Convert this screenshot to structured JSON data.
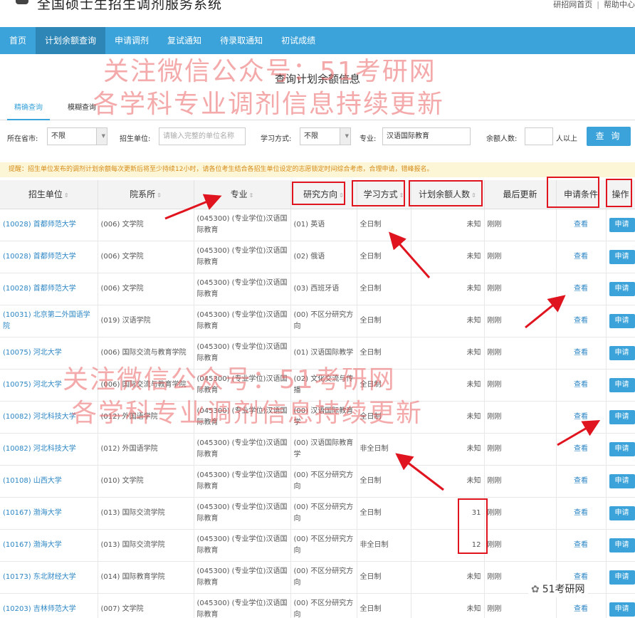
{
  "header": {
    "site_title": "全国硕士生招生调剂服务系统",
    "links": [
      "研招网首页",
      "帮助中心"
    ],
    "separator": "|"
  },
  "nav": {
    "items": [
      "首页",
      "计划余额查询",
      "申请调剂",
      "复试通知",
      "待录取通知",
      "初试成绩"
    ],
    "active_index": 1
  },
  "page_heading": "查询计划余额信息",
  "tabs": [
    "精确查询",
    "模糊查询"
  ],
  "filters": {
    "province_label": "所在省市:",
    "province_value": "不限",
    "unit_label": "招生单位:",
    "unit_placeholder": "请输入完整的单位名称",
    "mode_label": "学习方式:",
    "mode_value": "不限",
    "major_label": "专业:",
    "major_value": "汉语国际教育",
    "remaining_label": "余额人数:",
    "remaining_value": "",
    "remaining_suffix": "人以上",
    "query_button": "查 询"
  },
  "notice": "提醒：招生单位发布的调剂计划余额每次更新后将至少持续12小时，请各位考生结合各招生单位设定的志愿锁定时间综合考虑，合理申请，错峰报名。",
  "table": {
    "columns": [
      "招生单位",
      "院系所",
      "专业",
      "研究方向",
      "学习方式",
      "计划余额人数",
      "最后更新",
      "申请条件",
      "操作"
    ],
    "view_label": "查看",
    "apply_label": "申请",
    "rows": [
      {
        "unit": "(10028) 首都师范大学",
        "dept": "(006) 文学院",
        "major": "(045300) (专业学位)汉语国际教育",
        "direction": "(01) 英语",
        "mode": "全日制",
        "remaining": "未知",
        "updated": "刚刚"
      },
      {
        "unit": "(10028) 首都师范大学",
        "dept": "(006) 文学院",
        "major": "(045300) (专业学位)汉语国际教育",
        "direction": "(02) 俄语",
        "mode": "全日制",
        "remaining": "未知",
        "updated": "刚刚"
      },
      {
        "unit": "(10028) 首都师范大学",
        "dept": "(006) 文学院",
        "major": "(045300) (专业学位)汉语国际教育",
        "direction": "(03) 西班牙语",
        "mode": "全日制",
        "remaining": "未知",
        "updated": "刚刚"
      },
      {
        "unit": "(10031) 北京第二外国语学院",
        "dept": "(019) 汉语学院",
        "major": "(045300) (专业学位)汉语国际教育",
        "direction": "(00) 不区分研究方向",
        "mode": "全日制",
        "remaining": "未知",
        "updated": "刚刚"
      },
      {
        "unit": "(10075) 河北大学",
        "dept": "(006) 国际交流与教育学院",
        "major": "(045300) (专业学位)汉语国际教育",
        "direction": "(01) 汉语国际教学",
        "mode": "全日制",
        "remaining": "未知",
        "updated": "刚刚"
      },
      {
        "unit": "(10075) 河北大学",
        "dept": "(006) 国际交流与教育学院",
        "major": "(045300) (专业学位)汉语国际教育",
        "direction": "(02) 文化交流与传播",
        "mode": "全日制",
        "remaining": "未知",
        "updated": "刚刚"
      },
      {
        "unit": "(10082) 河北科技大学",
        "dept": "(012) 外国语学院",
        "major": "(045300) (专业学位)汉语国际教育",
        "direction": "(00) 汉语国际教育学",
        "mode": "全日制",
        "remaining": "未知",
        "updated": "刚刚"
      },
      {
        "unit": "(10082) 河北科技大学",
        "dept": "(012) 外国语学院",
        "major": "(045300) (专业学位)汉语国际教育",
        "direction": "(00) 汉语国际教育学",
        "mode": "非全日制",
        "remaining": "未知",
        "updated": "刚刚"
      },
      {
        "unit": "(10108) 山西大学",
        "dept": "(010) 文学院",
        "major": "(045300) (专业学位)汉语国际教育",
        "direction": "(00) 不区分研究方向",
        "mode": "全日制",
        "remaining": "未知",
        "updated": "刚刚"
      },
      {
        "unit": "(10167) 渤海大学",
        "dept": "(013) 国际交流学院",
        "major": "(045300) (专业学位)汉语国际教育",
        "direction": "(00) 不区分研究方向",
        "mode": "全日制",
        "remaining": "31",
        "updated": "刚刚"
      },
      {
        "unit": "(10167) 渤海大学",
        "dept": "(013) 国际交流学院",
        "major": "(045300) (专业学位)汉语国际教育",
        "direction": "(00) 不区分研究方向",
        "mode": "非全日制",
        "remaining": "12",
        "updated": "刚刚"
      },
      {
        "unit": "(10173) 东北财经大学",
        "dept": "(014) 国际教育学院",
        "major": "(045300) (专业学位)汉语国际教育",
        "direction": "(00) 不区分研究方向",
        "mode": "全日制",
        "remaining": "未知",
        "updated": "刚刚"
      },
      {
        "unit": "(10203) 吉林师范大学",
        "dept": "(007) 文学院",
        "major": "(045300) (专业学位)汉语国际教育",
        "direction": "(00) 不区分研究方向",
        "mode": "全日制",
        "remaining": "未知",
        "updated": "刚刚"
      }
    ]
  },
  "watermarks": [
    "关注微信公众号：51考研网",
    "各学科专业调剂信息持续更新",
    "关注微信公众号：51考研网",
    "各学科专业调剂信息持续更新"
  ],
  "wechat_badge": "51考研网",
  "colors": {
    "nav_bg": "#3ba3da",
    "nav_active": "#2d86b6",
    "link": "#2c86c4",
    "annotation_red": "#e0141e",
    "notice_text": "#d68b1a",
    "notice_bg": "#fcf6d6"
  }
}
